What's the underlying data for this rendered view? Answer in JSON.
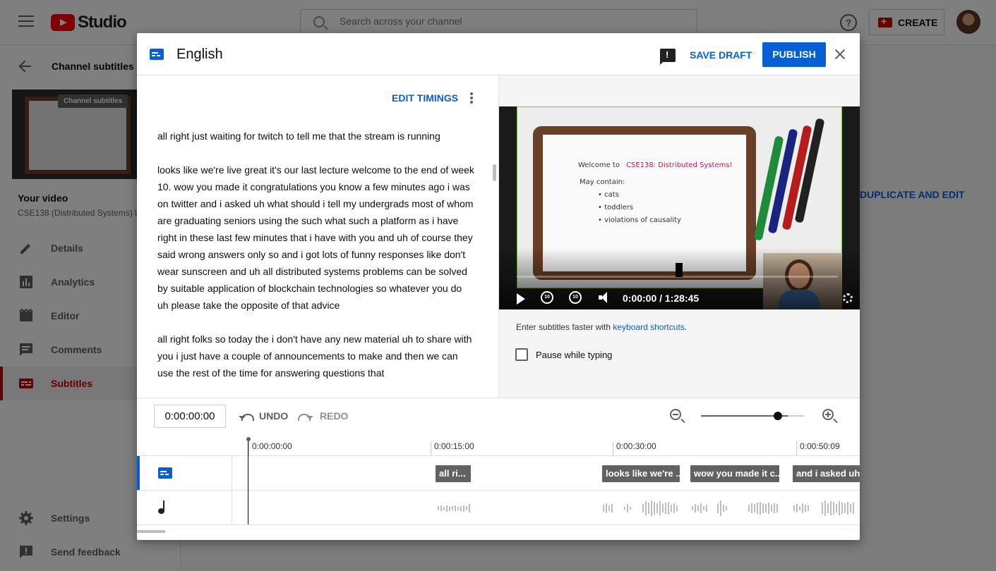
{
  "app": {
    "name": "Studio"
  },
  "topbar": {
    "search_placeholder": "Search across your channel",
    "create_label": "CREATE"
  },
  "sidebar": {
    "back_label": "Channel subtitles",
    "thumb_tooltip": "Channel subtitles",
    "your_video_label": "Your video",
    "video_name": "CSE138 (Distributed Systems) l",
    "items": [
      {
        "label": "Details",
        "icon": "pencil-icon"
      },
      {
        "label": "Analytics",
        "icon": "analytics-icon"
      },
      {
        "label": "Editor",
        "icon": "editor-icon"
      },
      {
        "label": "Comments",
        "icon": "comments-icon"
      },
      {
        "label": "Subtitles",
        "icon": "subtitles-icon",
        "active": true
      }
    ],
    "bottom_items": [
      {
        "label": "Settings",
        "icon": "gear-icon"
      },
      {
        "label": "Send feedback",
        "icon": "feedback-icon"
      }
    ]
  },
  "background": {
    "duplicate_label": "DUPLICATE AND EDIT"
  },
  "dialog": {
    "title": "English",
    "save_draft": "SAVE DRAFT",
    "publish": "PUBLISH",
    "edit_timings": "EDIT TIMINGS",
    "transcript": [
      "all right just waiting for twitch to tell me that the stream is running",
      "looks like we're live great it's our last lecture welcome to the end of week 10. wow you made it congratulations you know a few minutes ago i was on twitter and i asked uh what should i tell my undergrads most of whom are graduating seniors using the such what such a platform as i have right in these last few minutes that i have with you and uh of course they said wrong answers only so and i got lots of funny responses like don't wear sunscreen and uh all distributed systems problems can be solved by suitable application of blockchain technologies so whatever you do uh please take the opposite of that advice",
      "all right folks so today the i don't have any new material uh to share with you i just have a couple of announcements to make and then we can use the rest of the time for answering questions that"
    ],
    "video": {
      "time_display": "0:00:00 / 1:28:45",
      "board_lines": [
        "Welcome to",
        "CSE138: Distributed Systems!",
        "May contain:",
        "• cats",
        "• toddlers",
        "• violations of causality"
      ]
    },
    "shortcuts_text": "Enter subtitles faster with ",
    "shortcuts_link": "keyboard shortcuts",
    "shortcuts_end": ".",
    "pause_label": "Pause while typing",
    "pause_checked": false,
    "current_time": "0:00:00:00",
    "undo": "UNDO",
    "redo": "REDO",
    "zoom_level": 0.75,
    "ruler": [
      "0:00:00:00",
      "0:00:15:00",
      "0:00:30:00",
      "0:00:50:09"
    ],
    "cues": [
      "all ri...",
      "looks like we're ...",
      "wow you made it c...",
      "and i asked uh w"
    ]
  }
}
